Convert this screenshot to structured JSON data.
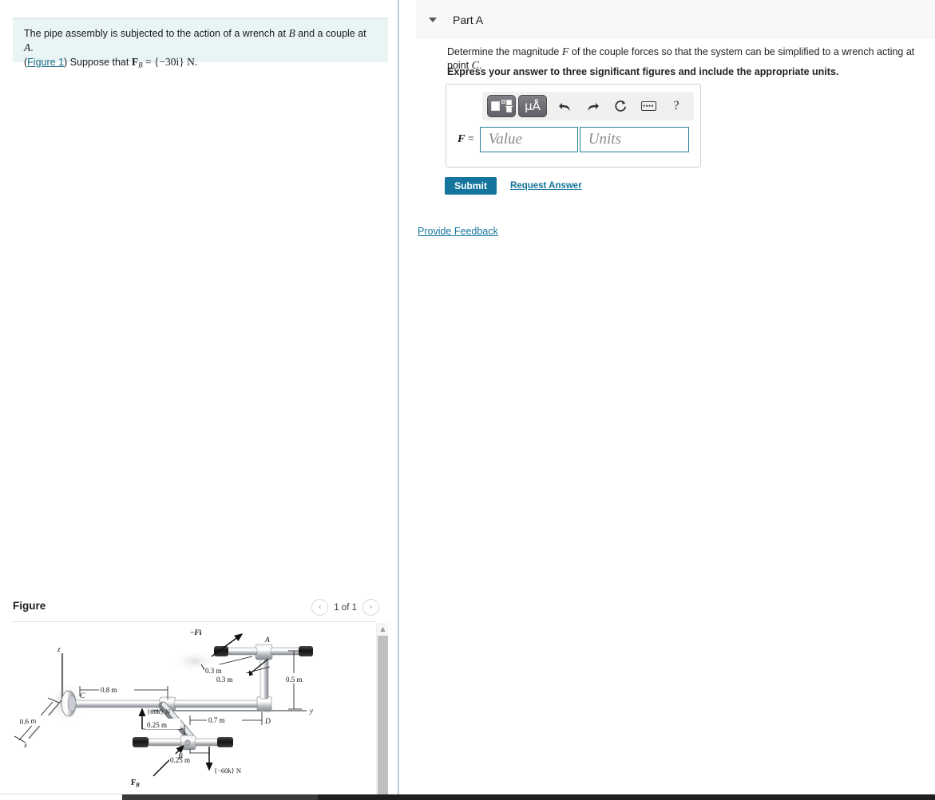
{
  "problem": {
    "text_before": "The pipe assembly is subjected to the action of a wrench at ",
    "point_b": "B",
    "text_mid": " and a couple at ",
    "point_a": "A",
    "text_end": ".",
    "figure_link": "Figure 1",
    "suppose_prefix": "Suppose that ",
    "force_symbol": "F",
    "force_sub": "B",
    "force_value": " = {−30i} N."
  },
  "part": {
    "label": "Part A",
    "caret_icon": "chevron-down-icon",
    "question_1a": "Determine the magnitude ",
    "question_symbol": "F",
    "question_1b": " of the couple forces so that the system can be simplified to a wrench acting at point ",
    "question_point": "C",
    "question_1c": ".",
    "question_2": "Express your answer to three significant figures and include the appropriate units."
  },
  "answer": {
    "label_f": "F",
    "label_eq": " =",
    "value_placeholder": "Value",
    "units_placeholder": "Units",
    "value_current": "",
    "units_current": "",
    "toolbar": {
      "template_icon": "math-template-icon",
      "units_icon": "μÅ",
      "undo_icon": "undo-icon",
      "redo_icon": "redo-icon",
      "reset_icon": "reset-icon",
      "keyboard_icon": "keyboard-icon",
      "help_icon": "?"
    }
  },
  "actions": {
    "submit": "Submit",
    "request_answer": "Request Answer",
    "provide_feedback": "Provide Feedback"
  },
  "figure_panel": {
    "title": "Figure",
    "prev_icon": "‹",
    "next_icon": "›",
    "page_label": "1 of 1",
    "scroll_up_icon": "▲"
  },
  "figure": {
    "alt": "Pipe assembly with wrench at B and couple at A",
    "labels": {
      "axis_z": "z",
      "axis_y": "y",
      "axis_x": "x",
      "point_a": "A",
      "point_b": "B",
      "point_c": "C",
      "point_d": "D",
      "force_neg_Fi": "−Fi",
      "force_Fi": "Fi",
      "force_FB": "F",
      "force_FB_sub": "B",
      "couple_pos": "{60k} N",
      "couple_neg": "{−60k} N",
      "dim_03a": "0.3 m",
      "dim_03b": "0.3 m",
      "dim_05": "0.5 m",
      "dim_08": "0.8 m",
      "dim_07": "0.7 m",
      "dim_06": "0.6 m",
      "dim_025a": "0.25 m",
      "dim_025b": "0.25 m"
    }
  },
  "colors": {
    "statement_bg": "#e9f4f4",
    "link": "#14759c",
    "submit_bg": "#14759c",
    "input_border": "#2b7f9b",
    "header_bg": "#f8f8f8",
    "divider": "#b9cfe0"
  }
}
